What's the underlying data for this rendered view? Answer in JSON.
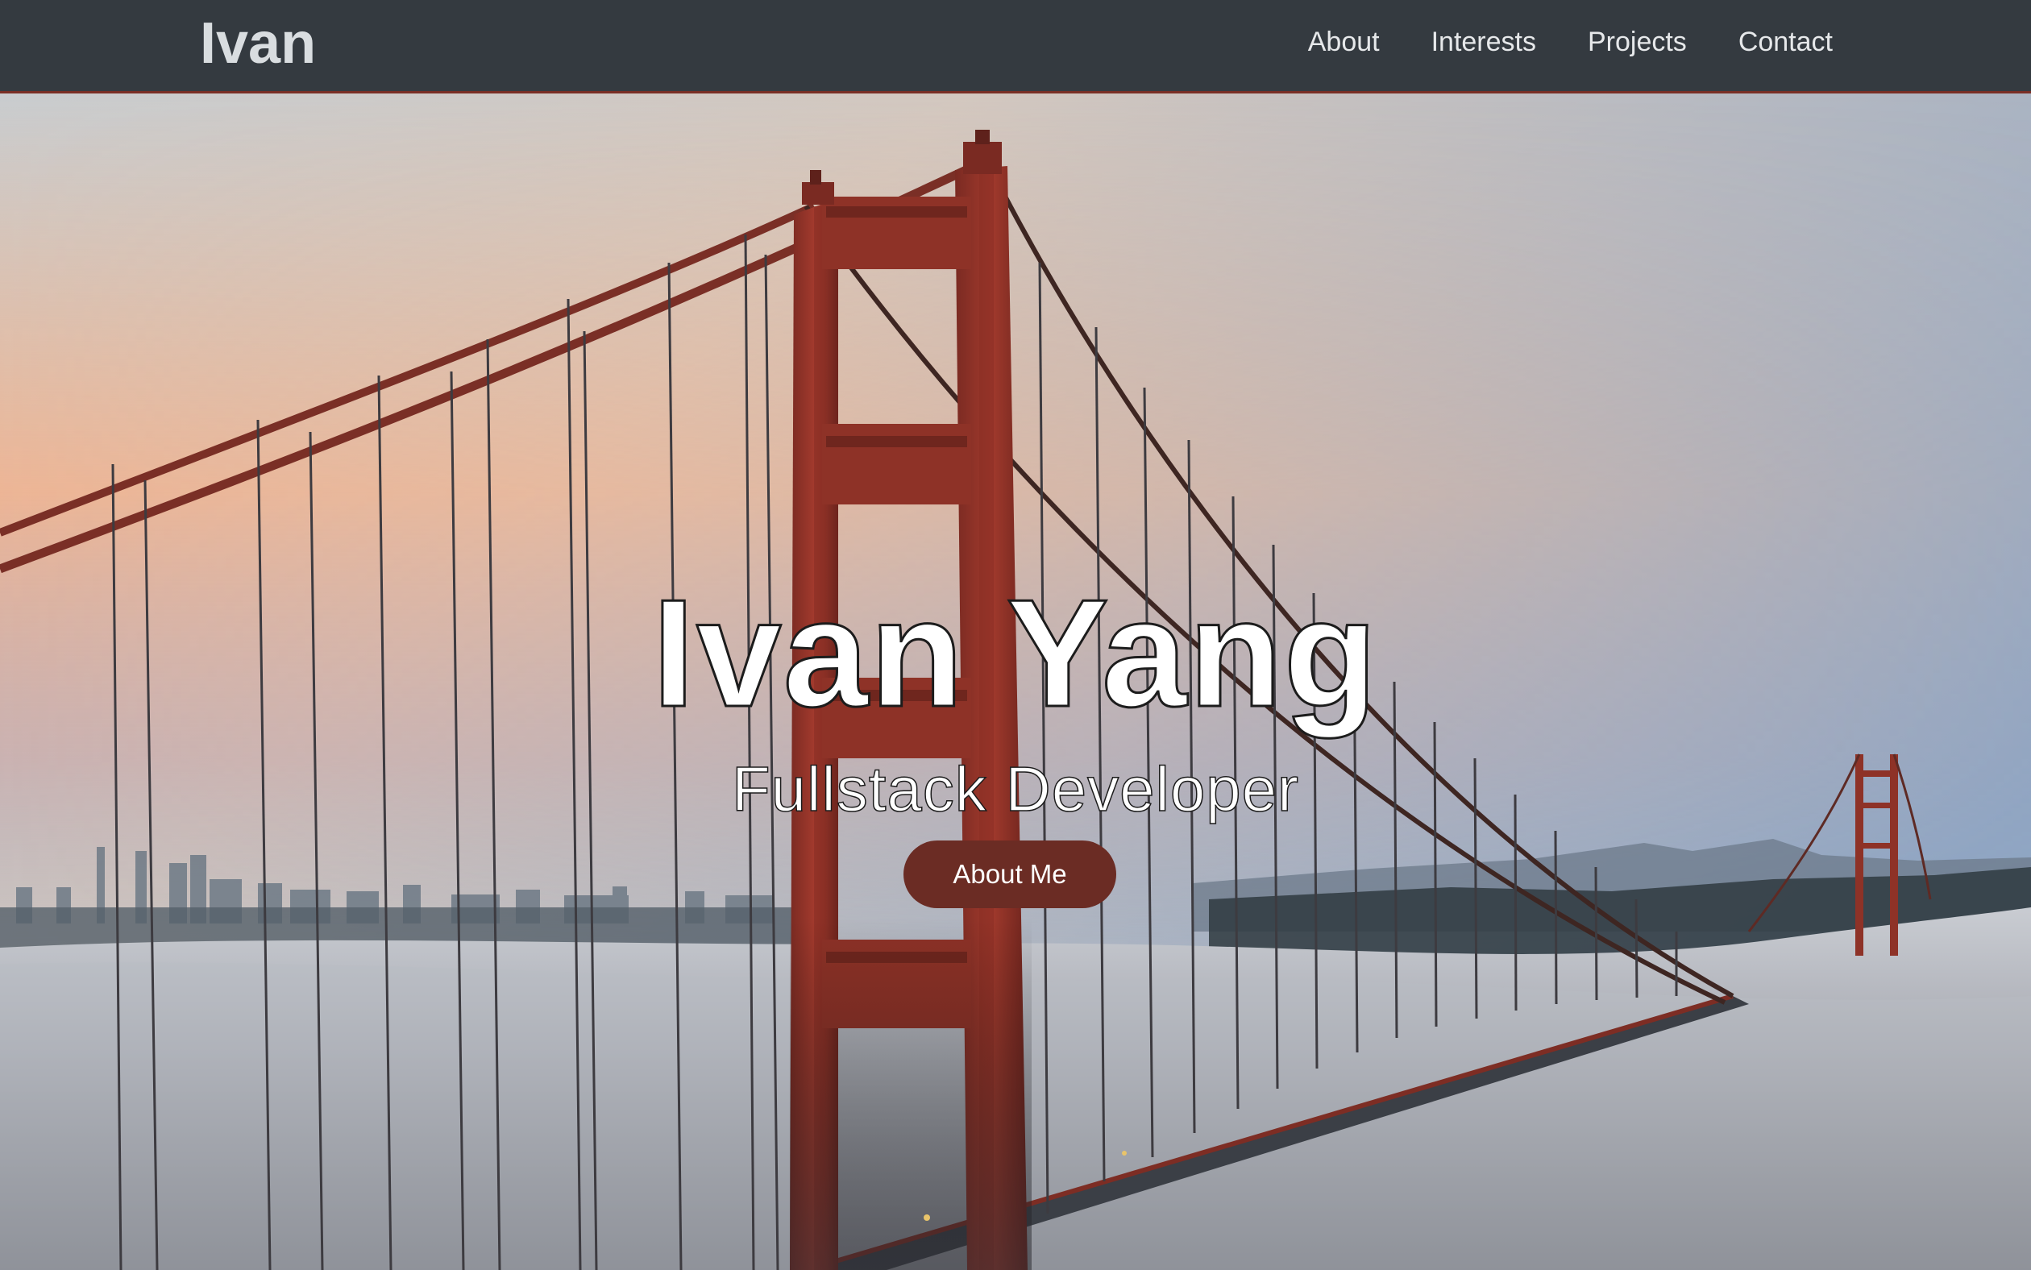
{
  "navbar": {
    "brand": "Ivan",
    "links": [
      {
        "label": "About"
      },
      {
        "label": "Interests"
      },
      {
        "label": "Projects"
      },
      {
        "label": "Contact"
      }
    ]
  },
  "hero": {
    "title": "Ivan Yang",
    "subtitle": "Fullstack Developer",
    "button_label": "About Me",
    "background_image": "golden-gate-bridge-in-fog"
  },
  "colors": {
    "navbar_bg": "#343a40",
    "accent": "#6b2c24",
    "bridge": "#8e3227"
  }
}
